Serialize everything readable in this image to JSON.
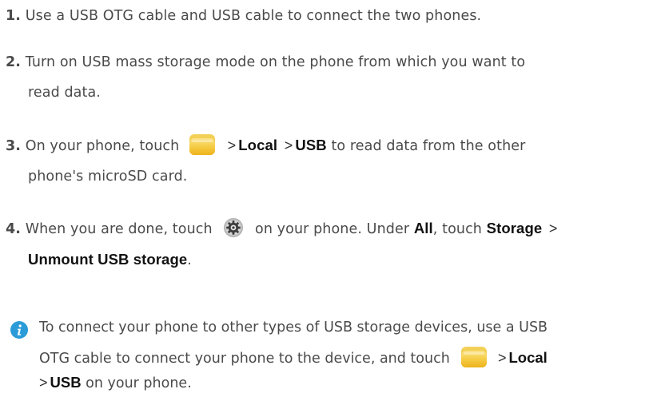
{
  "steps": [
    {
      "number": "1.",
      "text": "Use a USB OTG cable and USB cable to connect the two phones."
    },
    {
      "number": "2.",
      "text_line1": "Turn on USB mass storage mode on the phone from which you want to",
      "text_line2": "read data."
    },
    {
      "number": "3.",
      "pre": "On your phone, touch",
      "arrow1": ">",
      "bold1": "Local",
      "arrow2": ">",
      "bold2": "USB",
      "post": "to read data from the other",
      "line2": "phone's microSD card.",
      "icon": "file-manager-folder-icon"
    },
    {
      "number": "4.",
      "pre": "When you are done, touch",
      "mid": "on your phone. Under",
      "bold1": "All",
      "mid2": ", touch",
      "bold2": "Storage",
      "arrow": ">",
      "line2_bold": "Unmount USB storage",
      "line2_end": ".",
      "icon": "settings-gear-icon"
    }
  ],
  "note": {
    "icon": "info-icon",
    "line1": "To connect your phone to other types of USB storage devices, use a USB",
    "line2_pre": "OTG cable to connect your phone to the device, and touch",
    "arrow1": ">",
    "bold1": "Local",
    "arrow2": ">",
    "bold2": "USB",
    "line3_post": "on your phone."
  },
  "colors": {
    "text": "#4a4a4a",
    "bold": "#111111",
    "info_icon": "#2b9bd8",
    "folder": "#f2c230"
  }
}
